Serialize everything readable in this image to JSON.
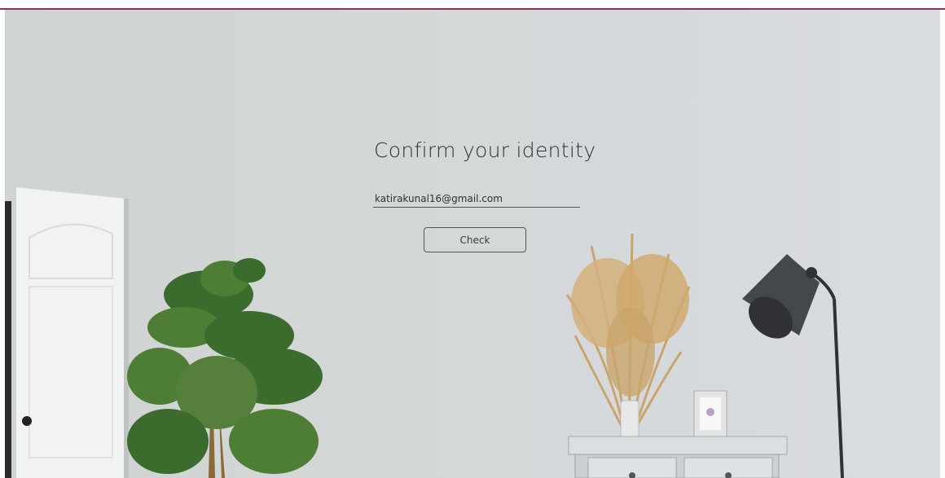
{
  "form": {
    "title": "Confirm your identity",
    "email_value": "katirakunal16@gmail.com",
    "check_label": "Check"
  },
  "colors": {
    "accent_bar": "#8b2d5f",
    "wall": "#d3d7d6",
    "text": "#2f3134"
  },
  "icons": [
    "door-icon",
    "plant-icon",
    "vase-icon",
    "picture-frame-icon",
    "lamp-icon",
    "cabinet-icon"
  ]
}
